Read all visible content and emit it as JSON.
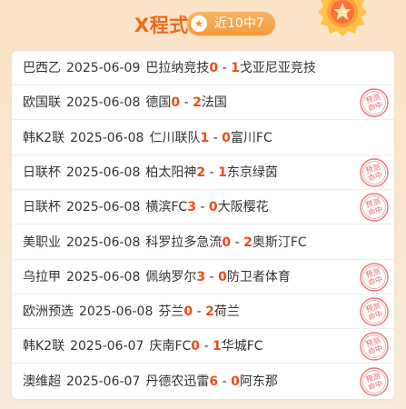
{
  "header": {
    "title": "X程式",
    "badge_label": "近10中7"
  },
  "stamp_text": "预测命中",
  "colors": {
    "accent": "#ef6a1a",
    "score": "#f04a16",
    "stamp": "#e44a4a"
  },
  "matches": [
    {
      "league": "巴西乙",
      "date": "2025-06-09",
      "home": "巴拉纳竞技",
      "home_score": "0",
      "sep": " - ",
      "away_score": "1",
      "away": "戈亚尼亚竞技",
      "hit": false
    },
    {
      "league": "欧国联",
      "date": "2025-06-08",
      "home": "德国",
      "home_score": "0",
      "sep": " - ",
      "away_score": "2",
      "away": "法国",
      "hit": true
    },
    {
      "league": "韩K2联",
      "date": "2025-06-08",
      "home": "仁川联队",
      "home_score": "1",
      "sep": " - ",
      "away_score": "0",
      "away": "富川FC",
      "hit": false
    },
    {
      "league": "日联杯",
      "date": "2025-06-08",
      "home": "柏太阳神",
      "home_score": "2",
      "sep": " - ",
      "away_score": "1",
      "away": "东京绿茵",
      "hit": true
    },
    {
      "league": "日联杯",
      "date": "2025-06-08",
      "home": "横滨FC",
      "home_score": "3",
      "sep": " - ",
      "away_score": "0",
      "away": "大阪樱花",
      "hit": true
    },
    {
      "league": "美职业",
      "date": "2025-06-08",
      "home": "科罗拉多急流",
      "home_score": "0",
      "sep": " - ",
      "away_score": "2",
      "away": "奥斯汀FC",
      "hit": false
    },
    {
      "league": "乌拉甲",
      "date": "2025-06-08",
      "home": "佩纳罗尔",
      "home_score": "3",
      "sep": " - ",
      "away_score": "0",
      "away": "防卫者体育",
      "hit": true
    },
    {
      "league": "欧洲预选",
      "date": "2025-06-08",
      "home": "芬兰",
      "home_score": "0",
      "sep": " - ",
      "away_score": "2",
      "away": "荷兰",
      "hit": true
    },
    {
      "league": "韩K2联",
      "date": "2025-06-07",
      "home": "庆南FC",
      "home_score": "0",
      "sep": " - ",
      "away_score": "1",
      "away": "华城FC",
      "hit": true
    },
    {
      "league": "澳维超",
      "date": "2025-06-07",
      "home": "丹德农迅雷",
      "home_score": "6",
      "sep": " - ",
      "away_score": "0",
      "away": "阿东那",
      "hit": true
    }
  ]
}
